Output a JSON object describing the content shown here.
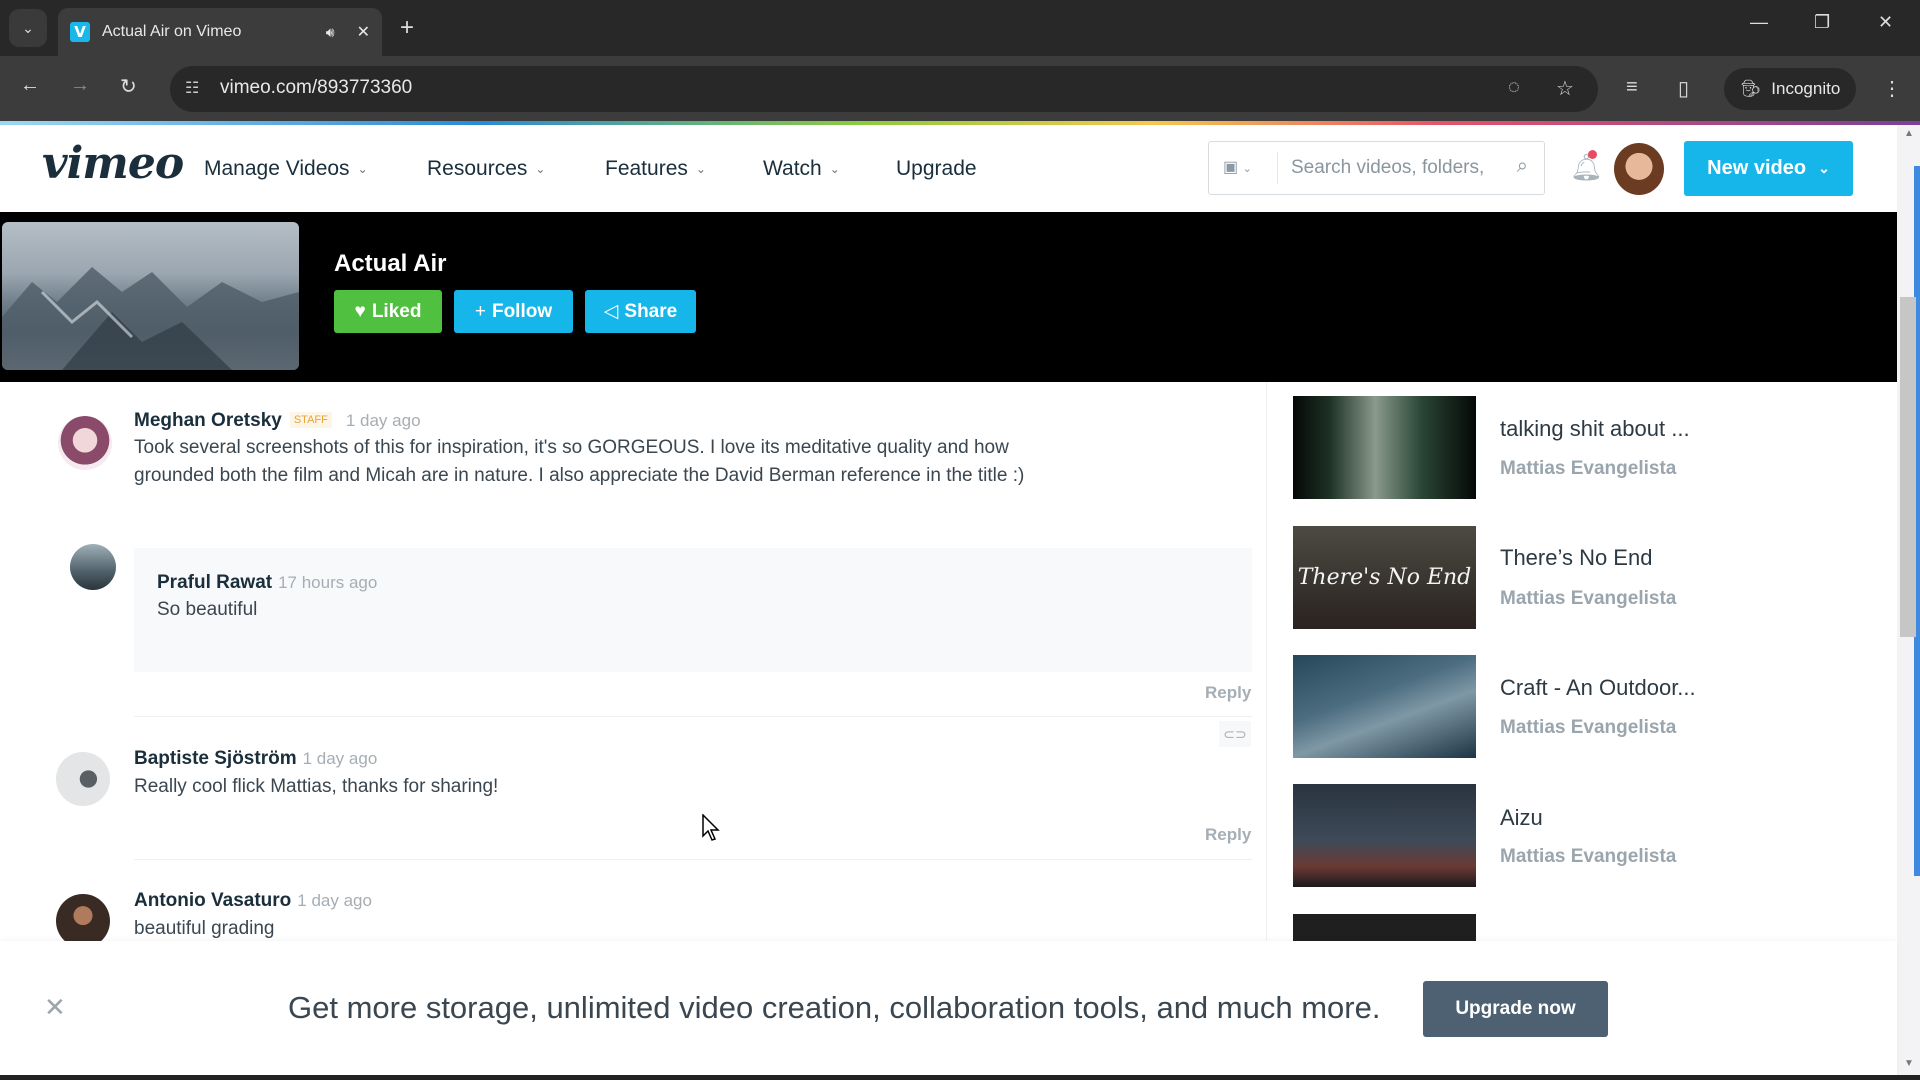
{
  "browser": {
    "tab_title": "Actual Air on Vimeo",
    "tab_favicon": "V",
    "url": "vimeo.com/893773360",
    "incognito_label": "Incognito",
    "icons": {
      "tab_search": "chevron-down-icon",
      "audio": "speaker-icon",
      "close_tab": "close-icon",
      "new_tab": "plus-icon",
      "back": "arrow-left-icon",
      "forward": "arrow-right-icon",
      "reload": "reload-icon",
      "site_info": "tune-icon",
      "eye_off": "eye-off-icon",
      "bookmark": "star-icon",
      "media": "media-queue-icon",
      "side_panel": "side-panel-icon",
      "menu": "kebab-menu-icon"
    }
  },
  "vimeo_header": {
    "logo": "vimeo",
    "nav": [
      {
        "label": "Manage Videos",
        "has_dropdown": true
      },
      {
        "label": "Resources",
        "has_dropdown": true
      },
      {
        "label": "Features",
        "has_dropdown": true
      },
      {
        "label": "Watch",
        "has_dropdown": true
      },
      {
        "label": "Upgrade",
        "has_dropdown": false
      }
    ],
    "search_placeholder": "Search videos, folders,",
    "new_video_label": "New video",
    "colors": {
      "accent": "#17b6ea",
      "notification": "#e84b5f"
    }
  },
  "video": {
    "title": "Actual Air",
    "buttons": {
      "liked": "Liked",
      "follow": "Follow",
      "share": "Share"
    },
    "colors": {
      "liked": "#4fc03f",
      "follow": "#17b6ea",
      "share": "#17b6ea"
    }
  },
  "comments": [
    {
      "author": "Meghan Oretsky",
      "badge": "STAFF",
      "time": "1 day ago",
      "text_lines": [
        "Took several screenshots of this for inspiration, it's so GORGEOUS. I love its meditative quality and how",
        "grounded both the film and Micah are in nature. I also appreciate the David Berman reference in the title :)"
      ],
      "replies": [
        {
          "author": "Praful Rawat",
          "time": "17 hours ago",
          "text": "So beautiful"
        }
      ],
      "reply_label": "Reply"
    },
    {
      "author": "Baptiste Sjöström",
      "time": "1 day ago",
      "text": "Really cool flick Mattias, thanks for sharing!",
      "reply_label": "Reply"
    },
    {
      "author": "Antonio Vasaturo",
      "time": "1 day ago",
      "text": "beautiful grading"
    }
  ],
  "related": [
    {
      "title": "talking shit about ...",
      "author": "Mattias Evangelista"
    },
    {
      "title": "There’s No End",
      "author": "Mattias Evangelista",
      "thumb_text": "There's No End"
    },
    {
      "title": "Craft - An Outdoor...",
      "author": "Mattias Evangelista"
    },
    {
      "title": "Aizu",
      "author": "Mattias Evangelista"
    },
    {
      "title": "",
      "author": ""
    }
  ],
  "banner": {
    "text": "Get more storage, unlimited video creation, collaboration tools, and much more.",
    "button": "Upgrade now"
  }
}
